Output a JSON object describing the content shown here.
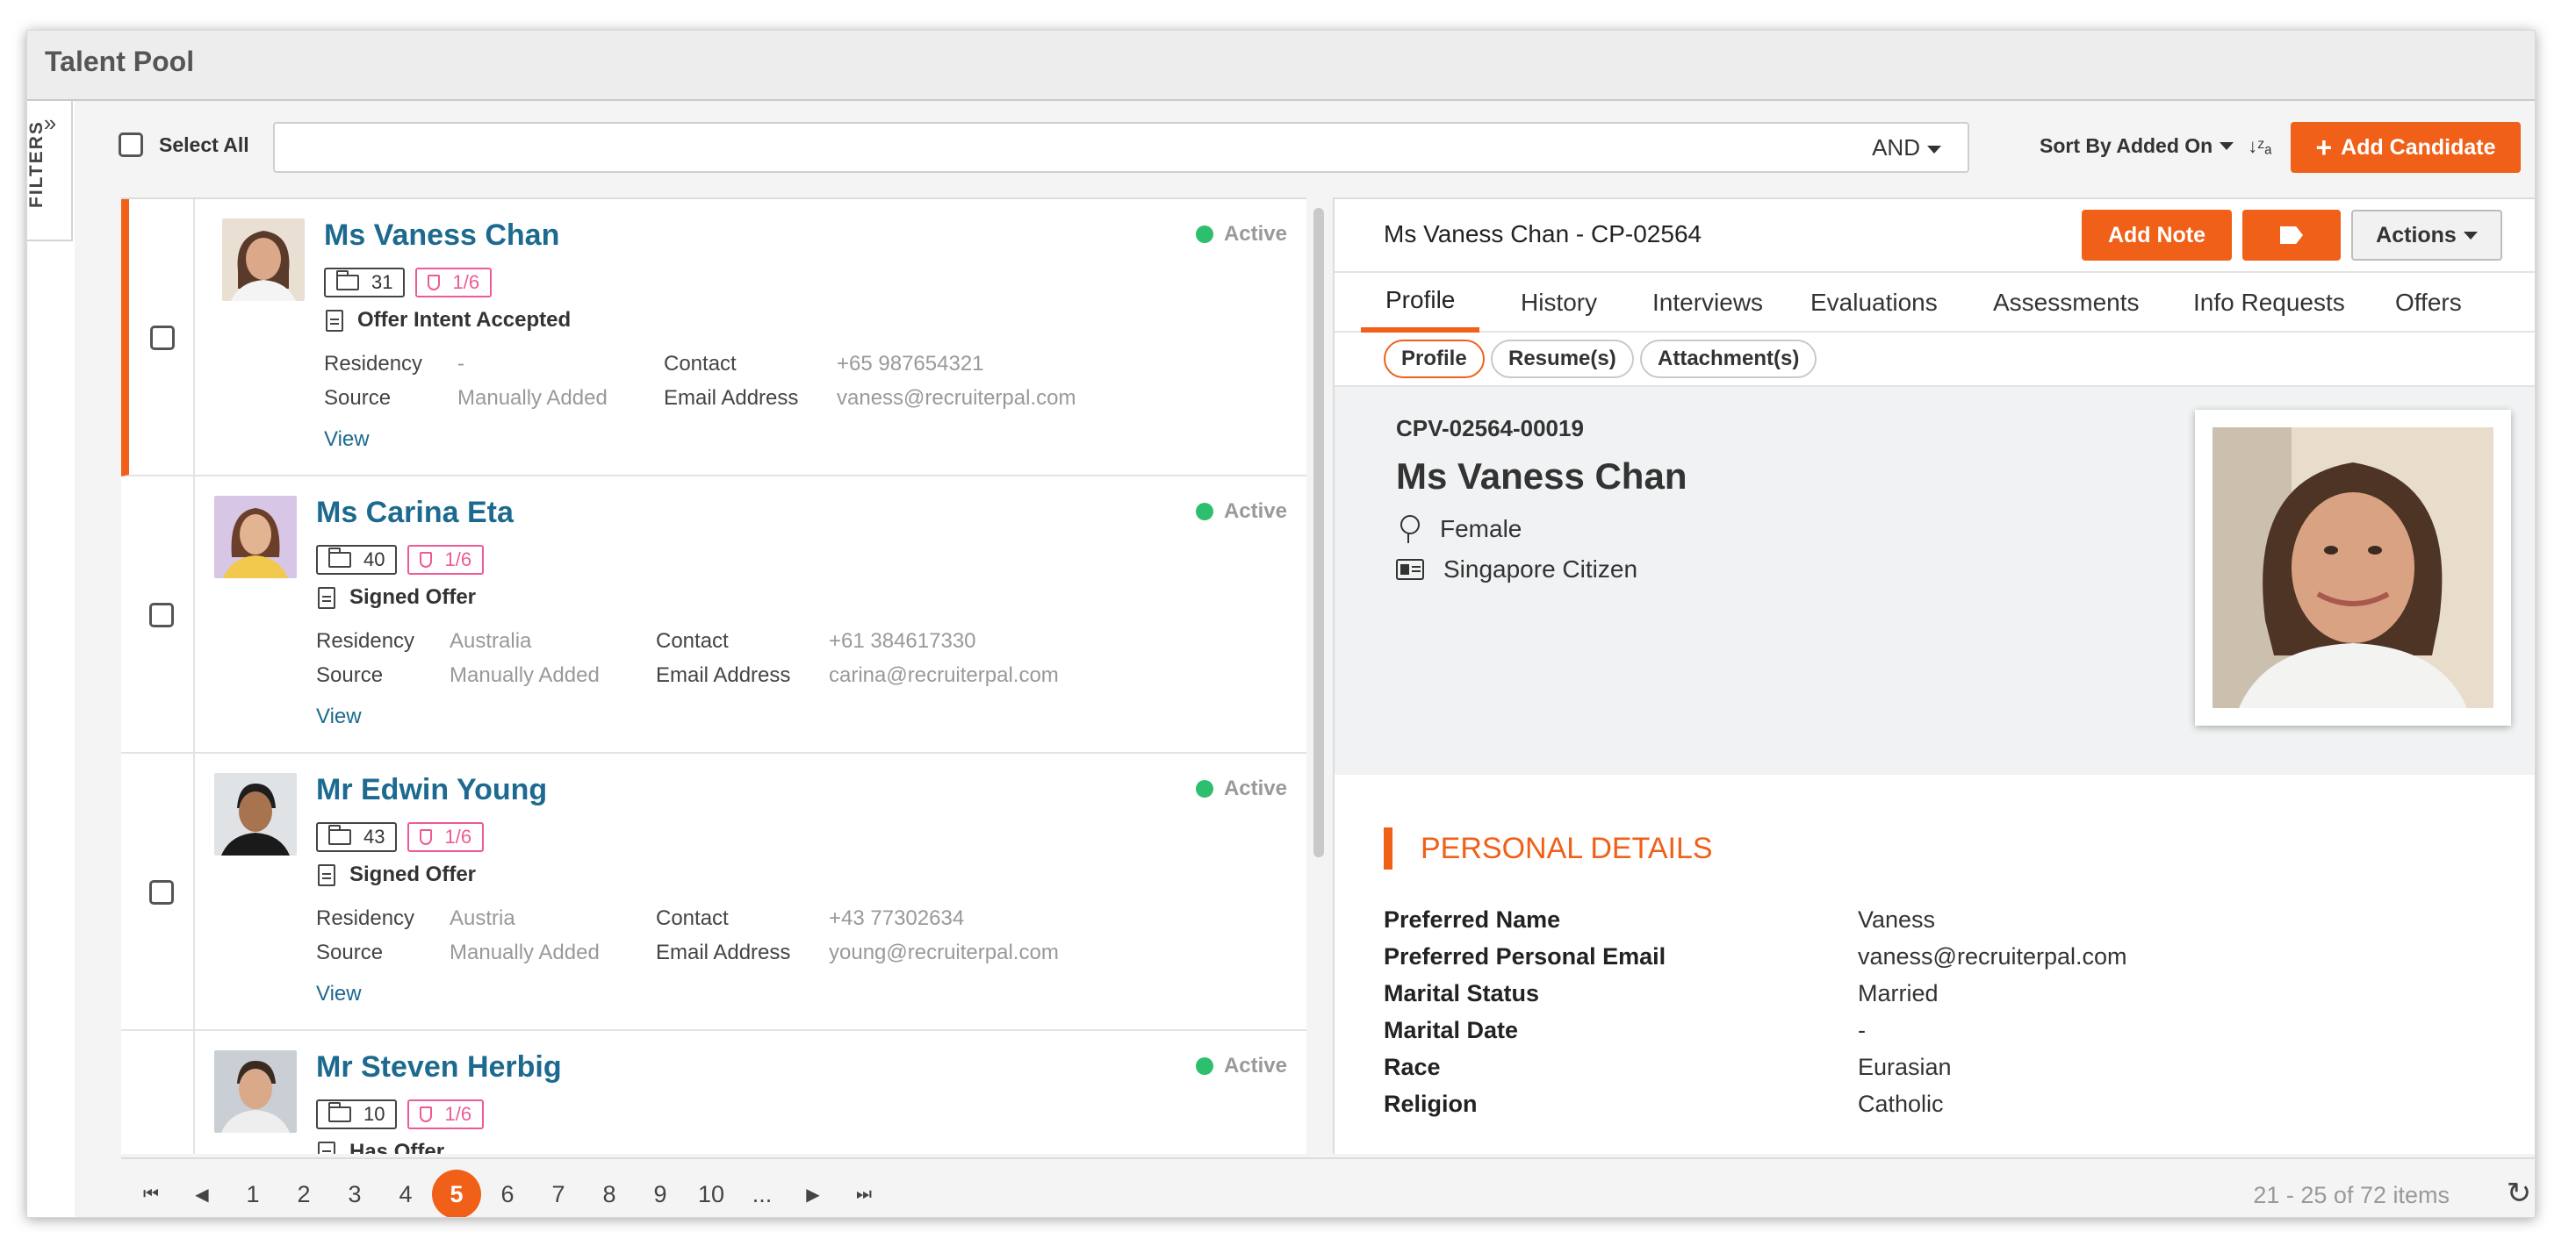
{
  "window": {
    "title": "Talent Pool"
  },
  "filters": {
    "label": "FILTERS",
    "toggle_icon": "double-chevron-right-icon"
  },
  "toolbar": {
    "select_all_label": "Select All",
    "search_value": "",
    "search_placeholder": "",
    "operator": "AND",
    "sort_label": "Sort By Added On",
    "sort_icon": "sort-alpha-icon",
    "add_candidate_label": "Add Candidate"
  },
  "candidates": [
    {
      "name": "Ms Vaness Chan",
      "status": "Active",
      "folders": "31",
      "score": "1/6",
      "stage": "Offer Intent Accepted",
      "residency_label": "Residency",
      "residency": "-",
      "source_label": "Source",
      "source": "Manually Added",
      "contact_label": "Contact",
      "contact": "+65 987654321",
      "email_label": "Email Address",
      "email": "vaness@recruiterpal.com",
      "view_label": "View",
      "selected": true
    },
    {
      "name": "Ms Carina Eta",
      "status": "Active",
      "folders": "40",
      "score": "1/6",
      "stage": "Signed Offer",
      "residency_label": "Residency",
      "residency": "Australia",
      "source_label": "Source",
      "source": "Manually Added",
      "contact_label": "Contact",
      "contact": "+61 384617330",
      "email_label": "Email Address",
      "email": "carina@recruiterpal.com",
      "view_label": "View",
      "selected": false
    },
    {
      "name": "Mr Edwin Young",
      "status": "Active",
      "folders": "43",
      "score": "1/6",
      "stage": "Signed Offer",
      "residency_label": "Residency",
      "residency": "Austria",
      "source_label": "Source",
      "source": "Manually Added",
      "contact_label": "Contact",
      "contact": "+43 77302634",
      "email_label": "Email Address",
      "email": "young@recruiterpal.com",
      "view_label": "View",
      "selected": false
    },
    {
      "name": "Mr Steven Herbig",
      "status": "Active",
      "folders": "10",
      "score": "1/6",
      "stage": "Has Offer",
      "residency_label": "",
      "residency": "",
      "source_label": "",
      "source": "",
      "contact_label": "",
      "contact": "",
      "email_label": "",
      "email": "",
      "view_label": "",
      "selected": false
    }
  ],
  "detail": {
    "title": "Ms Vaness Chan - CP-02564",
    "add_note_label": "Add Note",
    "actions_label": "Actions",
    "tabs": [
      {
        "label": "Profile",
        "active": true
      },
      {
        "label": "History"
      },
      {
        "label": "Interviews"
      },
      {
        "label": "Evaluations"
      },
      {
        "label": "Assessments"
      },
      {
        "label": "Info Requests"
      },
      {
        "label": "Offers"
      }
    ],
    "subtabs": [
      {
        "label": "Profile",
        "active": true
      },
      {
        "label": "Resume(s)"
      },
      {
        "label": "Attachment(s)"
      }
    ],
    "profile": {
      "code": "CPV-02564-00019",
      "name": "Ms Vaness Chan",
      "gender": "Female",
      "citizenship": "Singapore Citizen"
    },
    "personal_details": {
      "heading": "PERSONAL DETAILS",
      "rows": [
        {
          "label": "Preferred Name",
          "value": "Vaness"
        },
        {
          "label": "Preferred Personal Email",
          "value": "vaness@recruiterpal.com"
        },
        {
          "label": "Marital Status",
          "value": "Married"
        },
        {
          "label": "Marital Date",
          "value": "-"
        },
        {
          "label": "Race",
          "value": "Eurasian"
        },
        {
          "label": "Religion",
          "value": "Catholic"
        }
      ]
    }
  },
  "pagination": {
    "pages": [
      "1",
      "2",
      "3",
      "4",
      "5",
      "6",
      "7",
      "8",
      "9",
      "10",
      "..."
    ],
    "current": "5",
    "summary": "21 - 25 of 72 items"
  },
  "colors": {
    "accent": "#f06018",
    "link": "#1c6a8f",
    "active": "#2dbf6e",
    "pink": "#ee5a98"
  }
}
